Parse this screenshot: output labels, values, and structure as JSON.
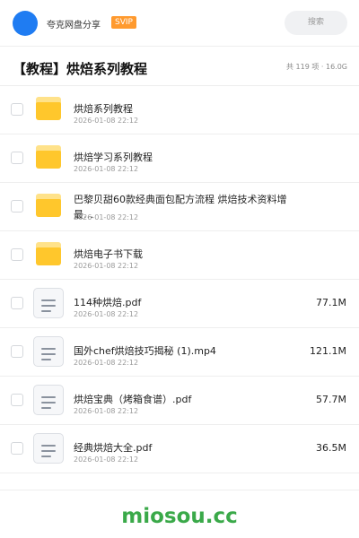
{
  "header": {
    "user_name": "夸克网盘分享",
    "badge": "SVIP",
    "search_placeholder": "搜索"
  },
  "page": {
    "title": "【教程】烘焙系列教程",
    "meta": "共 119 项 · 16.0G"
  },
  "files": [
    {
      "type": "folder",
      "name": "烘焙系列教程",
      "date": "2026-01-08 22:12",
      "size": ""
    },
    {
      "type": "folder",
      "name": "烘焙学习系列教程",
      "date": "2026-01-08 22:12",
      "size": ""
    },
    {
      "type": "folder",
      "name": "巴黎贝甜60款经典面包配方流程 烘焙技术资料增最…",
      "date": "2026-01-08 22:12",
      "size": ""
    },
    {
      "type": "folder",
      "name": "烘焙电子书下载",
      "date": "2026-01-08 22:12",
      "size": ""
    },
    {
      "type": "file",
      "name": "114种烘焙.pdf",
      "date": "2026-01-08 22:12",
      "size": "77.1M"
    },
    {
      "type": "file",
      "name": "国外chef烘焙技巧揭秘 (1).mp4",
      "date": "2026-01-08 22:12",
      "size": "121.1M"
    },
    {
      "type": "file",
      "name": "烘焙宝典（烤箱食谱）.pdf",
      "date": "2026-01-08 22:12",
      "size": "57.7M"
    },
    {
      "type": "file",
      "name": "经典烘焙大全.pdf",
      "date": "2026-01-08 22:12",
      "size": "36.5M"
    }
  ],
  "icons": {
    "folder": "folder-icon",
    "file": "document-icon"
  },
  "colors": {
    "avatar": "#1f7cf2",
    "svip_badge": "#ff9a2e",
    "folder": "#ffc72c",
    "watermark": "#3aa949"
  },
  "footer": {
    "watermark": "miosou.cc"
  }
}
